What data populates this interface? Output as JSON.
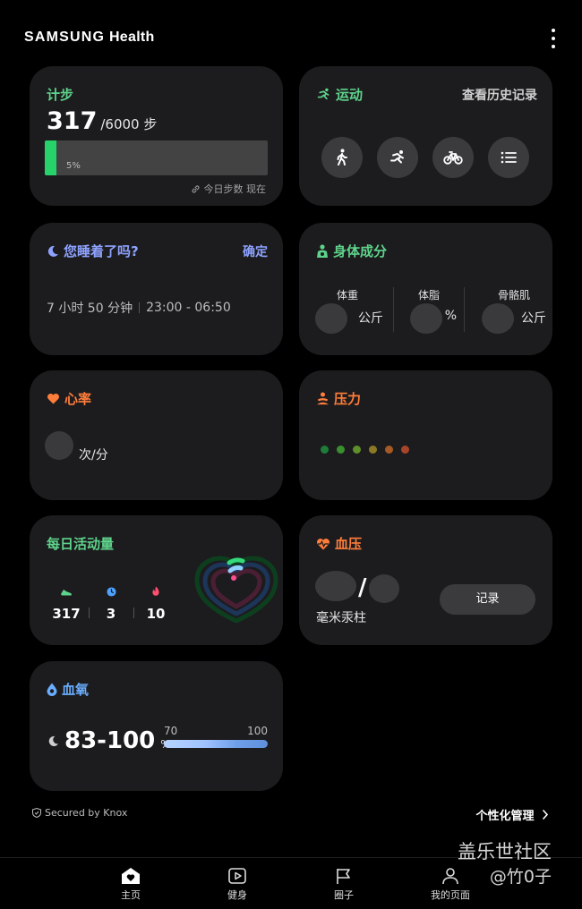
{
  "app": {
    "brand_bold": "SAMSUNG",
    "brand_light": "Health"
  },
  "steps": {
    "title": "计步",
    "count": "317",
    "goal": "/6000 步",
    "percent": "5%",
    "progress": 0.053,
    "footer": "今日步数 现在"
  },
  "exercise": {
    "title": "运动",
    "history_link": "查看历史记录",
    "buttons": [
      "walking-icon",
      "running-icon",
      "cycling-icon",
      "list-icon"
    ]
  },
  "sleep": {
    "title": "您睡着了吗?",
    "confirm": "确定",
    "duration": "7 小时 50 分钟",
    "range": "23:00 - 06:50"
  },
  "body": {
    "title": "身体成分",
    "weight_label": "体重",
    "weight_unit": "公斤",
    "fat_label": "体脂",
    "fat_unit": "%",
    "muscle_label": "骨骼肌",
    "muscle_unit": "公斤"
  },
  "heart": {
    "title": "心率",
    "unit": "次/分"
  },
  "stress": {
    "title": "压力",
    "dot_colors": [
      "#1e7d3a",
      "#3a8f2f",
      "#5e8f2a",
      "#8a7a25",
      "#a45a24",
      "#a8442a"
    ]
  },
  "activity": {
    "title": "每日活动量",
    "steps": "317",
    "minutes": "3",
    "calories": "10"
  },
  "bp": {
    "title": "血压",
    "slash": "/",
    "unit": "毫米汞柱",
    "record": "记录"
  },
  "spo2": {
    "title": "血氧",
    "value": "83-100",
    "unit": "%",
    "scale_min": "70",
    "scale_max": "100"
  },
  "footer": {
    "knox": "Secured by Knox",
    "personalize": "个性化管理"
  },
  "tabs": [
    {
      "label": "主页",
      "icon": "home-heart-icon"
    },
    {
      "label": "健身",
      "icon": "fitness-play-icon"
    },
    {
      "label": "圈子",
      "icon": "flag-icon"
    },
    {
      "label": "我的页面",
      "icon": "profile-icon"
    }
  ],
  "watermark": {
    "line1": "盖乐世社区",
    "line2": "@竹0子"
  },
  "colors": {
    "green": "#5ed38b",
    "blue": "#8ea2ff",
    "orange": "#ff7d3a",
    "sky": "#6aaeff",
    "card": "#1c1c1e",
    "progress": "#27d26a"
  }
}
